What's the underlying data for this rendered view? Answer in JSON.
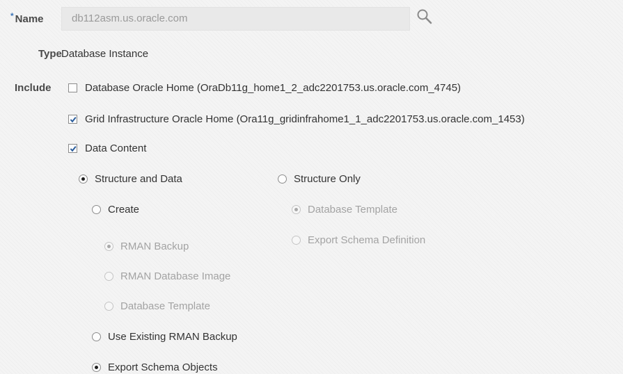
{
  "name_row": {
    "required_marker": "*",
    "label": "Name",
    "value": "db112asm.us.oracle.com"
  },
  "type_row": {
    "label": "Type",
    "value": "Database Instance"
  },
  "include": {
    "label": "Include",
    "db_oracle_home": {
      "label": "Database Oracle Home (OraDb11g_home1_2_adc2201753.us.oracle.com_4745)",
      "checked": false
    },
    "grid_oracle_home": {
      "label": "Grid Infrastructure Oracle Home (Ora11g_gridinfrahome1_1_adc2201753.us.oracle.com_1453)",
      "checked": true
    },
    "data_content": {
      "label": "Data Content",
      "checked": true
    }
  },
  "data_options": {
    "structure_and_data": {
      "label": "Structure and Data",
      "selected": true
    },
    "structure_only": {
      "label": "Structure Only",
      "selected": false
    },
    "create": {
      "label": "Create",
      "selected": false
    },
    "rman_backup": {
      "label": "RMAN Backup",
      "selected": true,
      "enabled": false
    },
    "rman_database_image": {
      "label": "RMAN Database Image",
      "selected": false,
      "enabled": false
    },
    "database_template_left": {
      "label": "Database Template",
      "selected": false,
      "enabled": false
    },
    "use_existing_rman_backup": {
      "label": "Use Existing RMAN Backup",
      "selected": false
    },
    "export_schema_objects": {
      "label": "Export Schema Objects",
      "selected": true
    },
    "database_template_right": {
      "label": "Database Template",
      "selected": true,
      "enabled": false
    },
    "export_schema_definition": {
      "label": "Export Schema Definition",
      "selected": false,
      "enabled": false
    }
  },
  "colors": {
    "required_marker": "#3d76b8",
    "check_mark": "#2a5d9c",
    "disabled_text": "#a3a3a3"
  }
}
